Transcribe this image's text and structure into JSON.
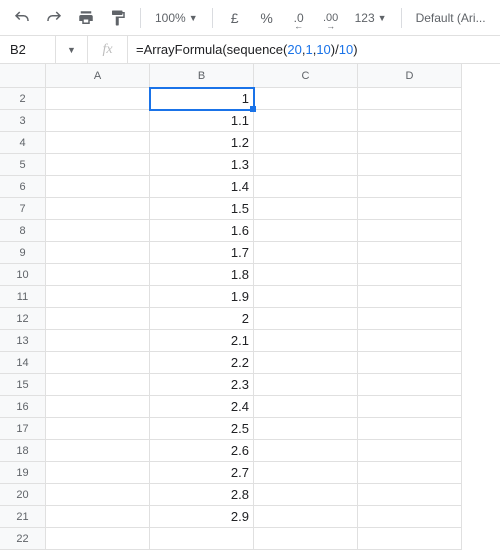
{
  "toolbar": {
    "zoom": "100%",
    "currency": "£",
    "percent": "%",
    "dec_dec": ".0",
    "dec_inc": ".00",
    "format123": "123",
    "font": "Default (Ari..."
  },
  "formula_bar": {
    "cell_ref": "B2",
    "fx_label": "fx",
    "formula_pre": "=ArrayFormula(sequence(",
    "formula_n1": "20",
    "formula_c1": ",",
    "formula_n2": "1",
    "formula_c2": ",",
    "formula_n3": "10",
    "formula_mid": ")/",
    "formula_n4": "10",
    "formula_end": ")"
  },
  "columns": [
    "A",
    "B",
    "C",
    "D"
  ],
  "rows": [
    {
      "num": "2",
      "b": "1"
    },
    {
      "num": "3",
      "b": "1.1"
    },
    {
      "num": "4",
      "b": "1.2"
    },
    {
      "num": "5",
      "b": "1.3"
    },
    {
      "num": "6",
      "b": "1.4"
    },
    {
      "num": "7",
      "b": "1.5"
    },
    {
      "num": "8",
      "b": "1.6"
    },
    {
      "num": "9",
      "b": "1.7"
    },
    {
      "num": "10",
      "b": "1.8"
    },
    {
      "num": "11",
      "b": "1.9"
    },
    {
      "num": "12",
      "b": "2"
    },
    {
      "num": "13",
      "b": "2.1"
    },
    {
      "num": "14",
      "b": "2.2"
    },
    {
      "num": "15",
      "b": "2.3"
    },
    {
      "num": "16",
      "b": "2.4"
    },
    {
      "num": "17",
      "b": "2.5"
    },
    {
      "num": "18",
      "b": "2.6"
    },
    {
      "num": "19",
      "b": "2.7"
    },
    {
      "num": "20",
      "b": "2.8"
    },
    {
      "num": "21",
      "b": "2.9"
    },
    {
      "num": "22",
      "b": ""
    }
  ]
}
